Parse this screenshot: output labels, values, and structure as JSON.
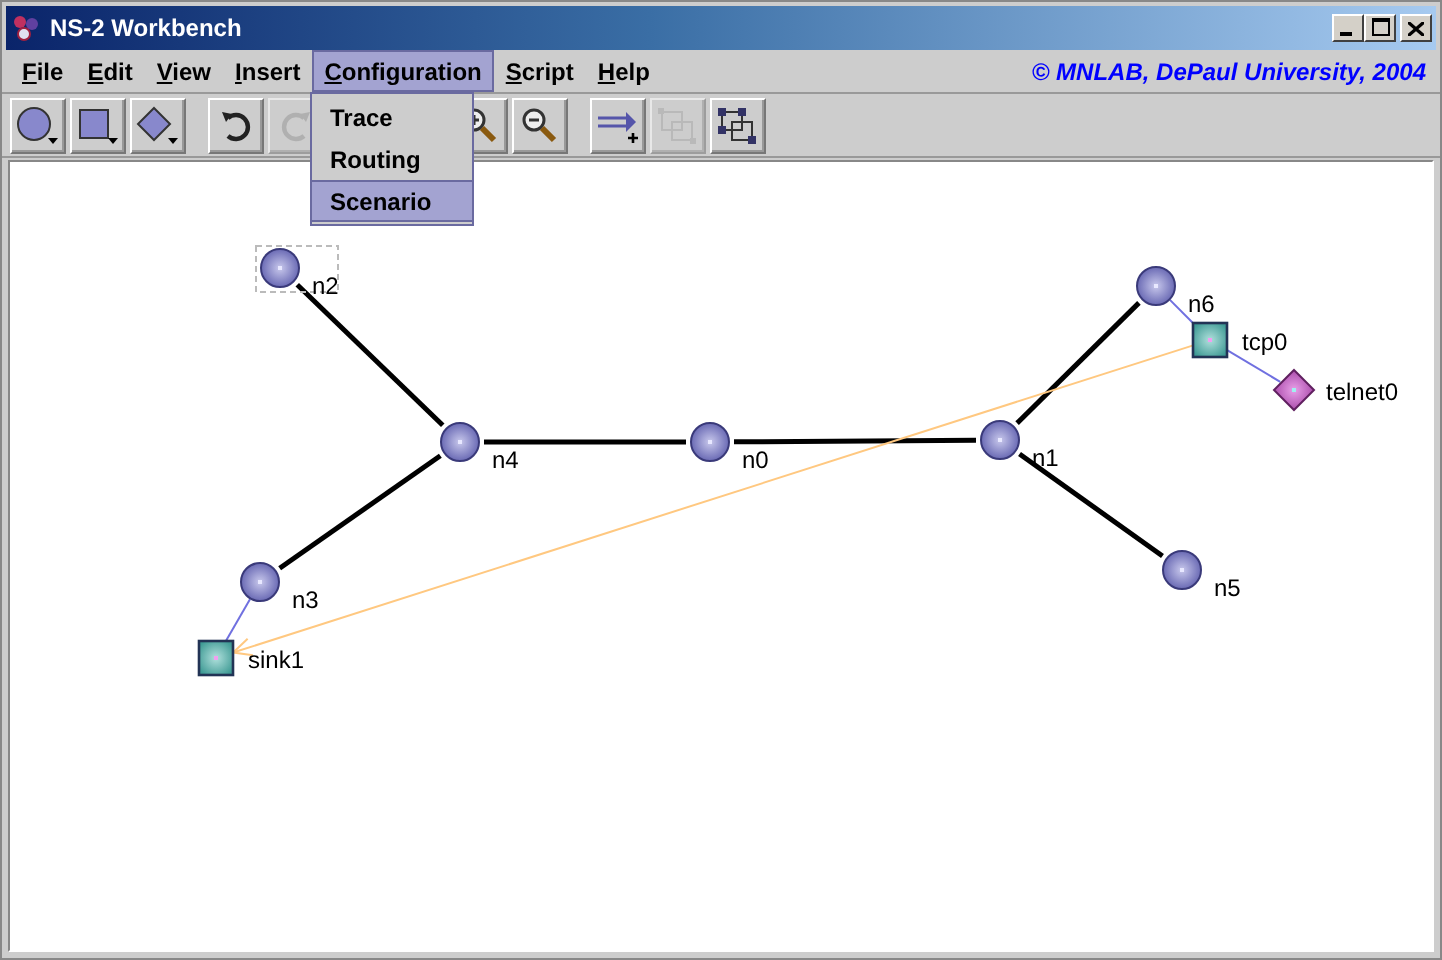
{
  "window": {
    "title": "NS-2 Workbench"
  },
  "menus": [
    {
      "label": "File",
      "selected": false
    },
    {
      "label": "Edit",
      "selected": false
    },
    {
      "label": "View",
      "selected": false
    },
    {
      "label": "Insert",
      "selected": false
    },
    {
      "label": "Configuration",
      "selected": true
    },
    {
      "label": "Script",
      "selected": false
    },
    {
      "label": "Help",
      "selected": false
    }
  ],
  "copyright": "© MNLAB, DePaul University, 2004",
  "open_menu": [
    {
      "label": "Trace",
      "selected": false
    },
    {
      "label": "Routing",
      "selected": false
    },
    {
      "label": "Scenario",
      "selected": true
    }
  ],
  "toolbar": [
    {
      "kind": "node",
      "disabled": false
    },
    {
      "kind": "agent",
      "disabled": false
    },
    {
      "kind": "application",
      "disabled": false
    },
    {
      "kind": "rotate",
      "disabled": false
    },
    {
      "kind": "redo",
      "disabled": true
    },
    {
      "kind": "zoom-in",
      "disabled": false
    },
    {
      "kind": "zoom-out",
      "disabled": false
    },
    {
      "kind": "add-link",
      "disabled": false
    },
    {
      "kind": "group",
      "disabled": true
    },
    {
      "kind": "layout",
      "disabled": false
    }
  ],
  "canvas": {
    "nodes": [
      {
        "kind": "node",
        "label": "n2",
        "selected": true
      },
      {
        "kind": "node",
        "label": "n4",
        "selected": false
      },
      {
        "kind": "node",
        "label": "n0",
        "selected": false
      },
      {
        "kind": "node",
        "label": "n1",
        "selected": false
      },
      {
        "kind": "node",
        "label": "n6",
        "selected": false
      },
      {
        "kind": "node",
        "label": "n5",
        "selected": false
      },
      {
        "kind": "node",
        "label": "n3",
        "selected": false
      },
      {
        "kind": "agent",
        "label": "tcp0",
        "selected": false
      },
      {
        "kind": "application",
        "label": "telnet0",
        "selected": false
      },
      {
        "kind": "agent",
        "label": "sink1",
        "selected": false
      }
    ]
  }
}
